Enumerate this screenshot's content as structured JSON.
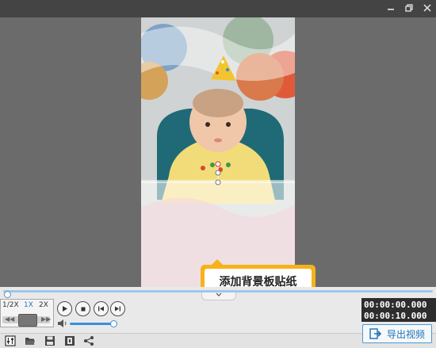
{
  "window": {
    "minimize_icon": "minimize-icon",
    "restore_icon": "restore-icon",
    "close_icon": "close-icon"
  },
  "preview": {
    "tooltip_text": "添加背景板贴纸"
  },
  "playback": {
    "speed_options": [
      "1/2X",
      "1X",
      "2X"
    ],
    "selected_speed": "1X",
    "progress": 0.0,
    "volume": 1.0,
    "current_time": "00:00:00.000",
    "total_time": "00:00:10.000"
  },
  "toolbar": {
    "export_label": "导出视频"
  },
  "colors": {
    "accent": "#2a78c8",
    "tooltip": "#f7b219",
    "time_bg": "#2d2d2d"
  }
}
